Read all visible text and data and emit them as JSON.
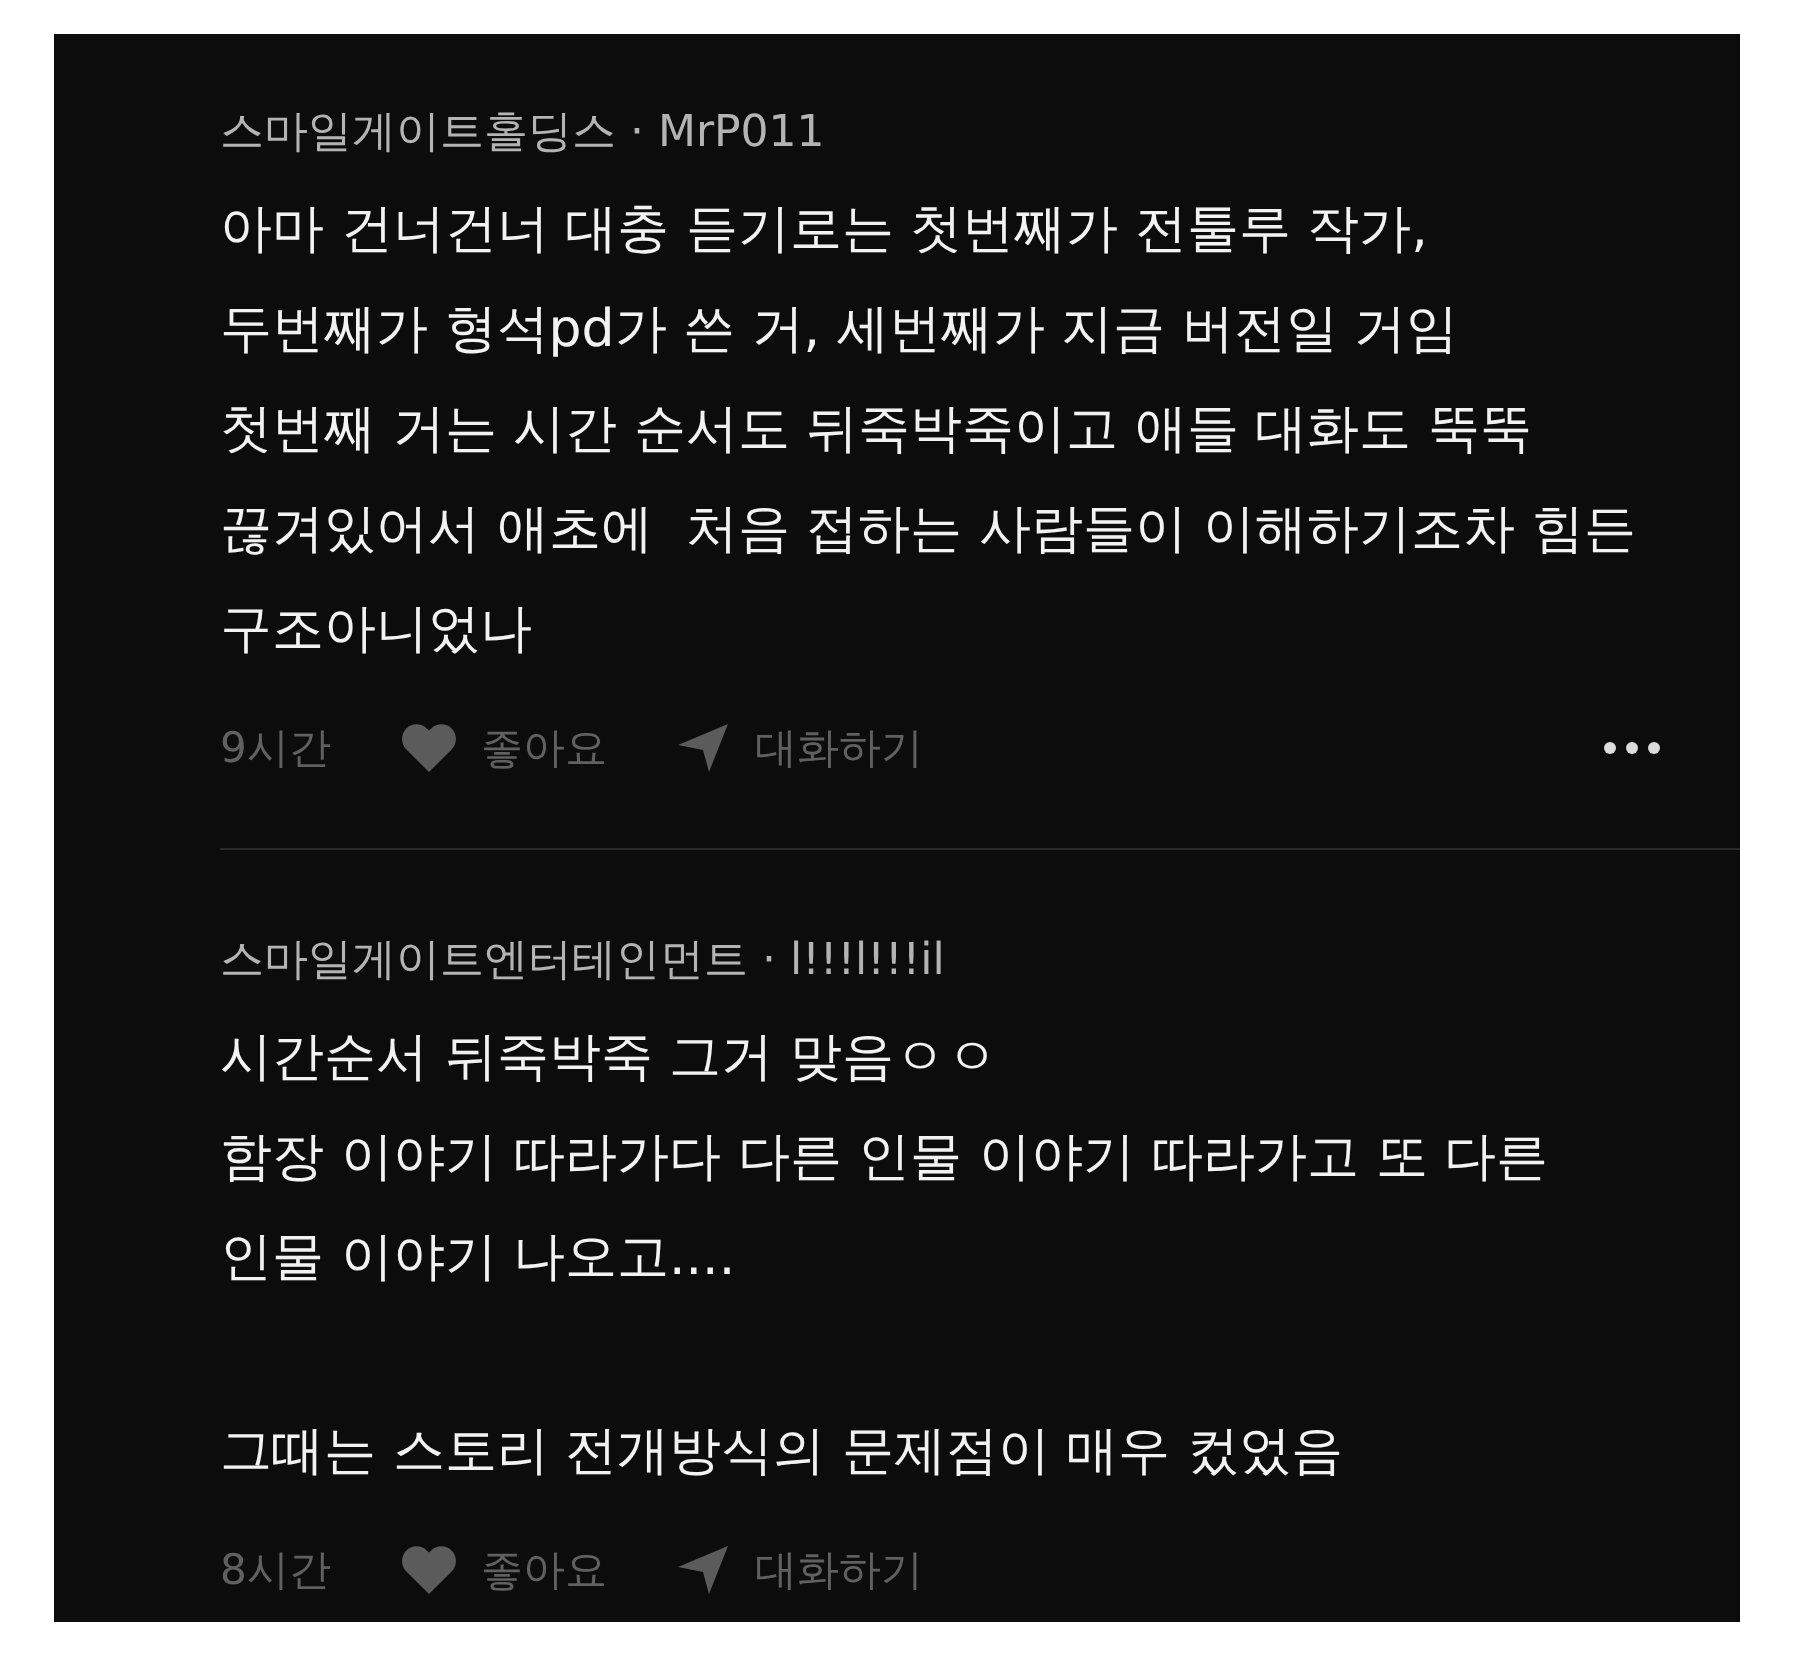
{
  "comments": [
    {
      "author": "스마일게이트홀딩스 · MrP011",
      "paragraphs": [
        "아마 건너건너 대충 듣기로는 첫번째가 전툴루 작가,\n두번째가 형석pd가 쓴 거, 세번째가 지금 버전일 거임\n첫번째 거는 시간 순서도 뒤죽박죽이고 애들 대화도 뚝뚝\n끊겨있어서 애초에  처음 접하는 사람들이 이해하기조차 힘든\n구조아니었나"
      ],
      "time": "9시간",
      "like_label": "좋아요",
      "reply_label": "대화하기",
      "more_button": true
    },
    {
      "author": "스마일게이트엔터테인먼트 · l!!!l!!!il",
      "paragraphs": [
        "시간순서 뒤죽박죽 그거 맞음ㅇㅇ\n함장 이야기 따라가다 다른 인물 이야기 따라가고 또 다른\n인물 이야기 나오고....",
        "그때는 스토리 전개방식의 문제점이 매우 컸었음"
      ],
      "time": "8시간",
      "like_label": "좋아요",
      "reply_label": "대화하기",
      "more_button": false
    }
  ]
}
